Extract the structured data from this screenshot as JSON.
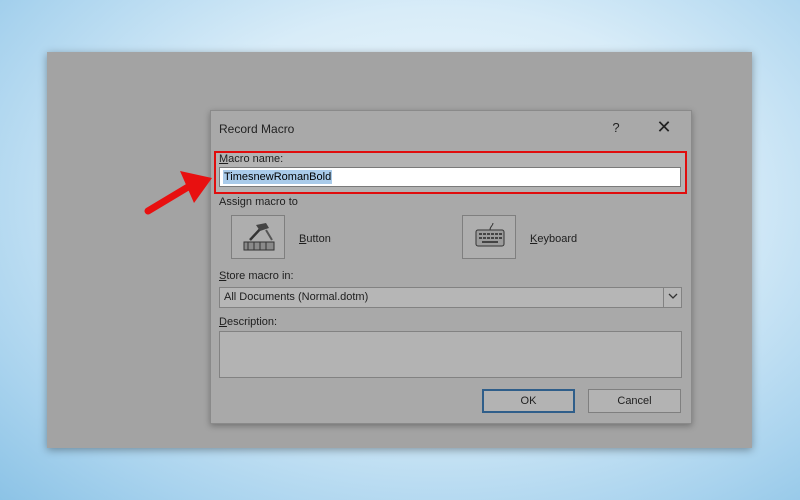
{
  "dialog": {
    "title": "Record Macro",
    "help": "?",
    "close": "✕",
    "macro_name_label": "Macro name:",
    "macro_name_value": "TimesnewRomanBold",
    "assign_label": "Assign macro to",
    "button_label": "Button",
    "keyboard_label": "Keyboard",
    "store_label": "Store macro in:",
    "store_value": "All Documents (Normal.dotm)",
    "description_label": "Description:",
    "description_value": "",
    "ok_label": "OK",
    "cancel_label": "Cancel"
  },
  "icons": {
    "button_icon": "hammer-toolbar-icon",
    "keyboard_icon": "keyboard-icon",
    "dropdown_icon": "chevron-down-icon",
    "annotation": "red-arrow-icon"
  },
  "colors": {
    "highlight": "#e00d0d",
    "selection": "#a9cbea",
    "default_button_border": "#2f5e8a"
  }
}
